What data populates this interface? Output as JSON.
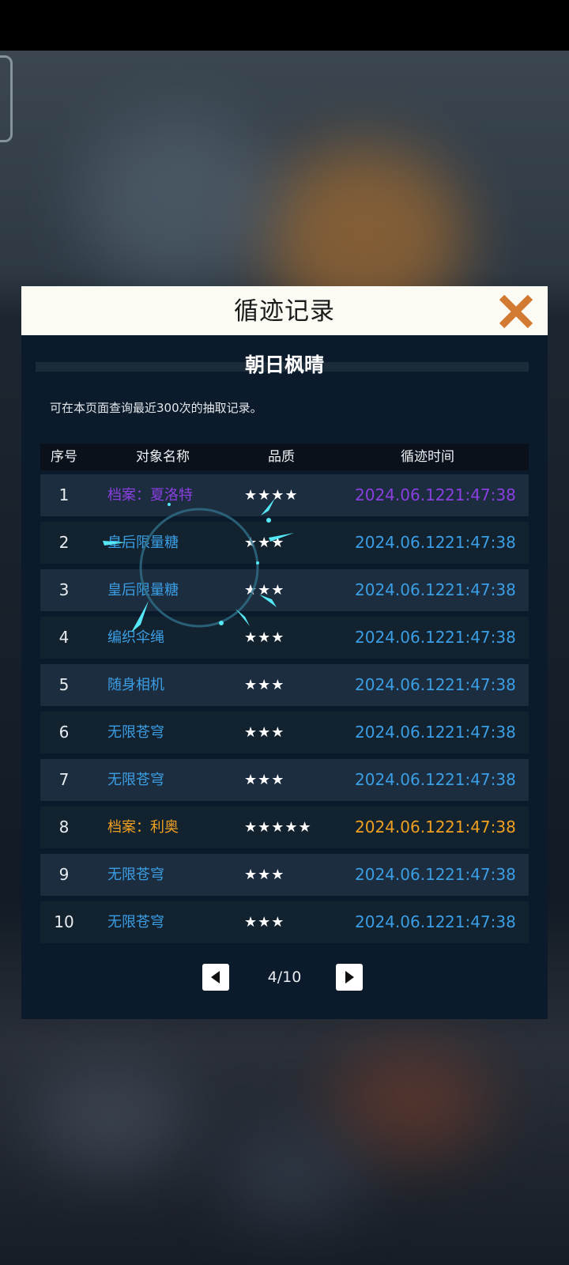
{
  "dialog": {
    "title": "循迹记录",
    "banner_title": "朝日枫晴",
    "note": "可在本页面查询最近300次的抽取记录。"
  },
  "table": {
    "headers": [
      "序号",
      "对象名称",
      "品质",
      "循迹时间"
    ],
    "rows": [
      {
        "index": "1",
        "name": "档案：夏洛特",
        "stars": "★★★★",
        "date": "2024.06.12",
        "time": "21:47:38",
        "color": "#8a3fe0"
      },
      {
        "index": "2",
        "name": "皇后限量糖",
        "stars": "★★★",
        "date": "2024.06.12",
        "time": "21:47:38",
        "color": "#3b9ee4"
      },
      {
        "index": "3",
        "name": "皇后限量糖",
        "stars": "★★★",
        "date": "2024.06.12",
        "time": "21:47:38",
        "color": "#3b9ee4"
      },
      {
        "index": "4",
        "name": "编织伞绳",
        "stars": "★★★",
        "date": "2024.06.12",
        "time": "21:47:38",
        "color": "#3b9ee4"
      },
      {
        "index": "5",
        "name": "随身相机",
        "stars": "★★★",
        "date": "2024.06.12",
        "time": "21:47:38",
        "color": "#3b9ee4"
      },
      {
        "index": "6",
        "name": "无限苍穹",
        "stars": "★★★",
        "date": "2024.06.12",
        "time": "21:47:38",
        "color": "#3b9ee4"
      },
      {
        "index": "7",
        "name": "无限苍穹",
        "stars": "★★★",
        "date": "2024.06.12",
        "time": "21:47:38",
        "color": "#3b9ee4"
      },
      {
        "index": "8",
        "name": "档案：利奥",
        "stars": "★★★★★",
        "date": "2024.06.12",
        "time": "21:47:38",
        "color": "#f0a020"
      },
      {
        "index": "9",
        "name": "无限苍穹",
        "stars": "★★★",
        "date": "2024.06.12",
        "time": "21:47:38",
        "color": "#3b9ee4"
      },
      {
        "index": "10",
        "name": "无限苍穹",
        "stars": "★★★",
        "date": "2024.06.12",
        "time": "21:47:38",
        "color": "#3b9ee4"
      }
    ]
  },
  "pager": {
    "text": "4/10",
    "prev_icon": "triangle-left-icon",
    "next_icon": "triangle-right-icon"
  },
  "icons": {
    "close": "close-x-icon"
  },
  "colors": {
    "accent_close": "#d27a32",
    "header_bg": "#fbfbf4",
    "dialog_bg": "#0c1b2b"
  }
}
